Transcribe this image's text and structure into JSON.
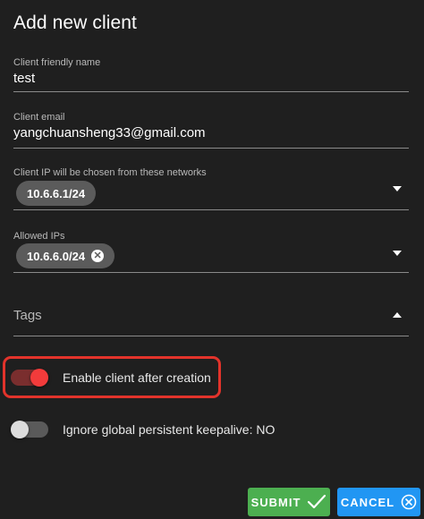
{
  "dialog": {
    "title": "Add new client"
  },
  "fields": {
    "name": {
      "label": "Client friendly name",
      "value": "test"
    },
    "email": {
      "label": "Client email",
      "value": "yangchuansheng33@gmail.com"
    },
    "networks": {
      "label": "Client IP will be chosen from these networks",
      "chip": "10.6.6.1/24"
    },
    "allowed_ips": {
      "label": "Allowed IPs",
      "chip": "10.6.6.0/24"
    },
    "tags": {
      "label": "Tags"
    }
  },
  "toggles": {
    "enable": {
      "label": "Enable client after creation",
      "on": true
    },
    "keepalive": {
      "label": "Ignore global persistent keepalive: NO",
      "on": false
    }
  },
  "buttons": {
    "submit": {
      "label": "SUBMIT",
      "icon": "check-icon"
    },
    "cancel": {
      "label": "CANCEL",
      "icon": "close-circle-icon"
    }
  },
  "colors": {
    "background": "#1f1f1f",
    "toggle_on_track": "#7a2e2e",
    "toggle_on_thumb": "#f23b3b",
    "toggle_off_track": "#5a5a5a",
    "toggle_off_thumb": "#dcdcdc",
    "highlight": "#e2332b",
    "submit": "#4caf50",
    "cancel": "#2196f3"
  }
}
